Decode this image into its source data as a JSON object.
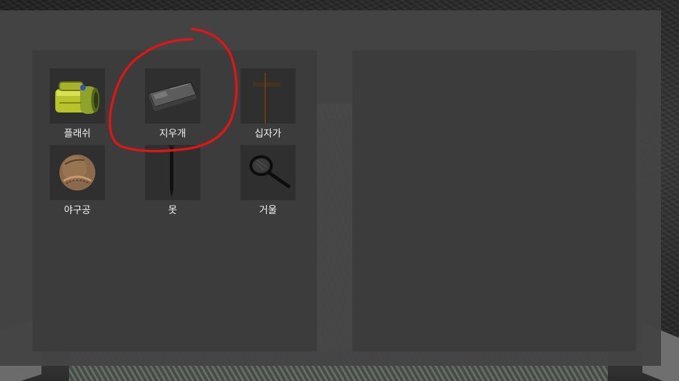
{
  "inventory": {
    "items": [
      {
        "label": "플래쉬",
        "icon": "flashlight-icon"
      },
      {
        "label": "지우개",
        "icon": "eraser-icon"
      },
      {
        "label": "십자가",
        "icon": "cross-icon"
      },
      {
        "label": "야구공",
        "icon": "baseball-icon"
      },
      {
        "label": "못",
        "icon": "nail-icon"
      },
      {
        "label": "거울",
        "icon": "hand-mirror-icon"
      }
    ],
    "highlighted_item": "지우개"
  },
  "colors": {
    "panel": "#444444",
    "subpanel": "#3c3c3c",
    "slot": "#2f2f2f",
    "label_text": "#f2f2f2",
    "annotation": "#e01515"
  }
}
